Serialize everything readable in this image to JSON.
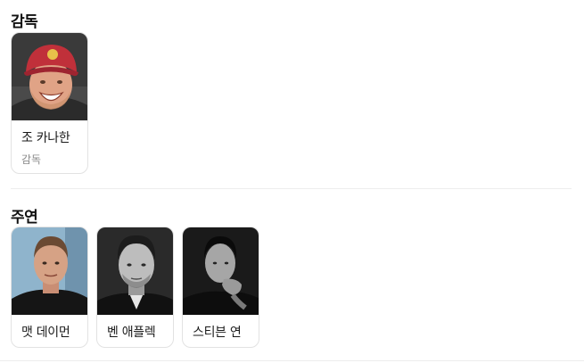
{
  "director_section": {
    "title": "감독",
    "people": [
      {
        "name": "조 카나한",
        "role": "감독"
      }
    ]
  },
  "cast_section": {
    "title": "주연",
    "people": [
      {
        "name": "맷 데이먼"
      },
      {
        "name": "벤 애플렉"
      },
      {
        "name": "스티븐 연"
      }
    ]
  }
}
